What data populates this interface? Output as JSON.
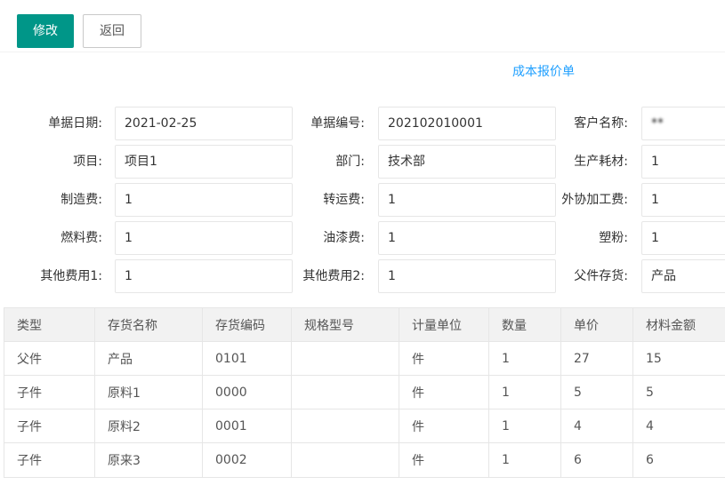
{
  "toolbar": {
    "edit_label": "修改",
    "back_label": "返回"
  },
  "document": {
    "title": "成本报价单"
  },
  "form": {
    "rows": [
      [
        {
          "label": "单据日期:",
          "value": "2021-02-25"
        },
        {
          "label": "单据编号:",
          "value": "202102010001"
        },
        {
          "label": "客户名称:",
          "value": "**"
        }
      ],
      [
        {
          "label": "项目:",
          "value": "项目1"
        },
        {
          "label": "部门:",
          "value": "技术部"
        },
        {
          "label": "生产耗材:",
          "value": "1"
        }
      ],
      [
        {
          "label": "制造费:",
          "value": "1"
        },
        {
          "label": "转运费:",
          "value": "1"
        },
        {
          "label": "外协加工费:",
          "value": "1"
        }
      ],
      [
        {
          "label": "燃料费:",
          "value": "1"
        },
        {
          "label": "油漆费:",
          "value": "1"
        },
        {
          "label": "塑粉:",
          "value": "1"
        }
      ],
      [
        {
          "label": "其他费用1:",
          "value": "1"
        },
        {
          "label": "其他费用2:",
          "value": "1"
        },
        {
          "label": "父件存货:",
          "value": "产品"
        }
      ]
    ]
  },
  "table": {
    "columns": [
      "类型",
      "存货名称",
      "存货编码",
      "规格型号",
      "计量单位",
      "数量",
      "单价",
      "材料金额"
    ],
    "rows": [
      [
        "父件",
        "产品",
        "0101",
        "",
        "件",
        "1",
        "27",
        "15"
      ],
      [
        "子件",
        "原料1",
        "0000",
        "",
        "件",
        "1",
        "5",
        "5"
      ],
      [
        "子件",
        "原料2",
        "0001",
        "",
        "件",
        "1",
        "4",
        "4"
      ],
      [
        "子件",
        "原来3",
        "0002",
        "",
        "件",
        "1",
        "6",
        "6"
      ]
    ]
  },
  "colors": {
    "primary": "#009688",
    "title": "#1e9fff",
    "table_header_bg": "#f2f2f2",
    "border": "#e6e6e6"
  }
}
